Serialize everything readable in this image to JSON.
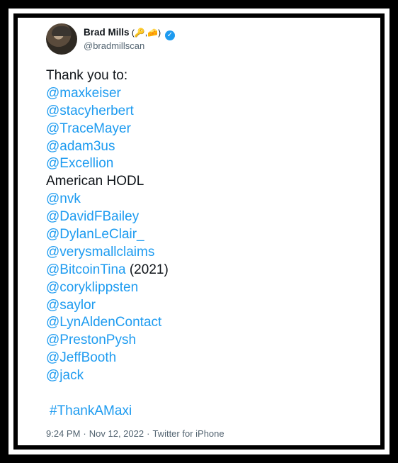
{
  "author": {
    "display_name": "Brad Mills",
    "name_suffix": " (🔑,🧀)",
    "handle": "@bradmillscan"
  },
  "tweet": {
    "intro": "Thank you to:",
    "lines": [
      {
        "type": "mention",
        "text": "@maxkeiser"
      },
      {
        "type": "mention",
        "text": "@stacyherbert"
      },
      {
        "type": "mention",
        "text": "@TraceMayer"
      },
      {
        "type": "mention",
        "text": "@adam3us"
      },
      {
        "type": "mention",
        "text": "@Excellion"
      },
      {
        "type": "text",
        "text": "American HODL"
      },
      {
        "type": "mention",
        "text": "@nvk"
      },
      {
        "type": "mention",
        "text": "@DavidFBailey"
      },
      {
        "type": "mention",
        "text": "@DylanLeClair_"
      },
      {
        "type": "mention",
        "text": "@verysmallclaims"
      },
      {
        "type": "mention_with_note",
        "text": "@BitcoinTina",
        "note": " (2021)"
      },
      {
        "type": "mention",
        "text": "@coryklippsten"
      },
      {
        "type": "mention",
        "text": "@saylor"
      },
      {
        "type": "mention",
        "text": "@LynAldenContact"
      },
      {
        "type": "mention",
        "text": "@PrestonPysh"
      },
      {
        "type": "mention",
        "text": "@JeffBooth"
      },
      {
        "type": "mention",
        "text": "@jack"
      }
    ],
    "hashtag": "#ThankAMaxi"
  },
  "meta": {
    "time": "9:24 PM",
    "date": "Nov 12, 2022",
    "source": "Twitter for iPhone",
    "separator": "·"
  },
  "colors": {
    "link": "#1d9bf0",
    "text": "#0f1419",
    "secondary": "#536471",
    "verified": "#1d9bf0"
  }
}
